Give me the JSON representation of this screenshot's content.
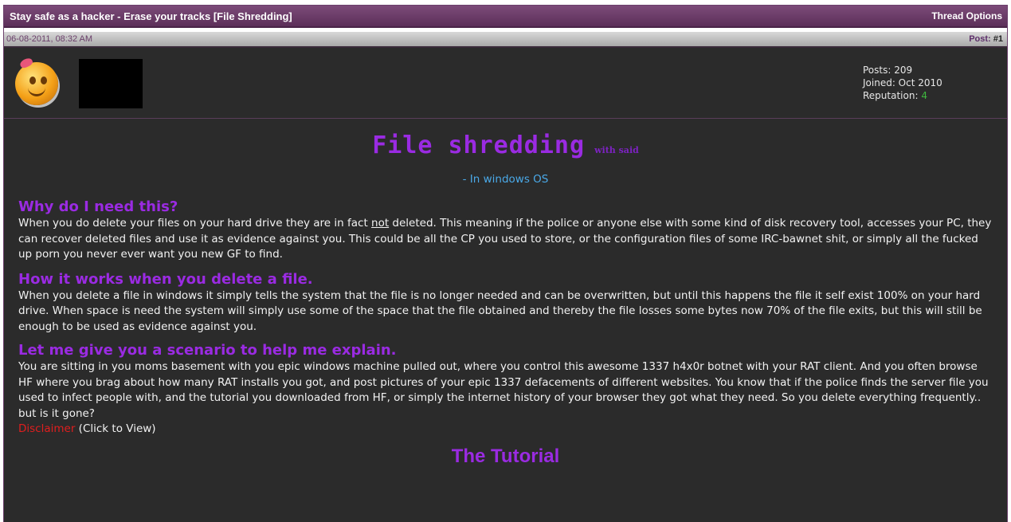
{
  "thread": {
    "title": "Stay safe as a hacker - Erase your tracks [File Shredding]",
    "options_label": "Thread Options"
  },
  "post": {
    "date": "06-08-2011, 08:32 AM",
    "post_label": "Post: ",
    "post_number": "#1"
  },
  "author": {
    "posts": "Posts: 209",
    "joined": "Joined: Oct 2010",
    "reputation_label": "Reputation: ",
    "reputation_value": "4"
  },
  "content": {
    "title": "File shredding",
    "title_suffix": "with said",
    "subtitle": "- In windows OS",
    "sections": [
      {
        "heading": "Why do I need this?",
        "text_before_not": "When you do delete your files on your hard drive they are in fact ",
        "underlined": "not",
        "text_after_not": " deleted. This meaning if the police or anyone else with some kind of disk recovery tool, accesses your PC, they can recover deleted files and use it as evidence against you. This could be all the CP you used to store, or the configuration files of some IRC-bawnet shit, or simply all the fucked up porn you never ever want you new GF to find."
      },
      {
        "heading": "How it works when you delete a file.",
        "text": "When you delete a file in windows it simply tells the system that the file is no longer needed and can be overwritten, but until this happens the file it self exist 100% on your hard drive. When space is need the system will simply use some of the space that the file obtained and thereby the file losses some bytes now 70% of the file exits, but this will still be enough to be used as evidence against you."
      },
      {
        "heading": "Let me give you a scenario to help me explain.",
        "text": "You are sitting in you moms basement with you epic windows machine pulled out, where you control this awesome 1337 h4x0r botnet with your RAT client. And you often browse HF where you brag about how many RAT installs you got, and post pictures of your epic 1337 defacements of different websites. You know that if the police finds the server file you used to infect people with, and the tutorial you downloaded from HF, or simply the internet history of your browser they got what they need. So you delete everything frequently.. but is it gone?"
      }
    ],
    "disclaimer_label": "Disclaimer",
    "click_to_view": " (Click to View)",
    "tutorial_heading": "The Tutorial"
  },
  "colors": {
    "header_purple": "#6b3a68",
    "heading_purple": "#9a2be2",
    "link_blue": "#4aa9e8",
    "disclaimer_red": "#e01e1e",
    "reputation_green": "#3fb83f",
    "body_bg": "#2b2b2b"
  }
}
